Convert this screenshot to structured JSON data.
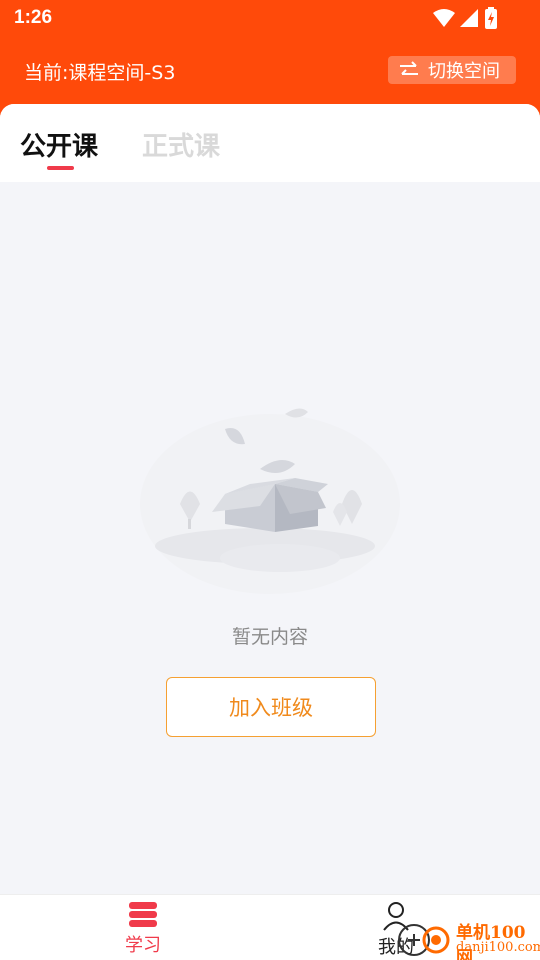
{
  "status_bar": {
    "time": "1:26",
    "icons": [
      "wifi-icon",
      "signal-icon",
      "battery-icon"
    ]
  },
  "header": {
    "current_space": "当前:课程空间-S3",
    "switch_label": "切换空间",
    "background_color": "#ff4a0a"
  },
  "tabs": [
    {
      "label": "公开课",
      "active": true
    },
    {
      "label": "正式课",
      "active": false
    }
  ],
  "empty_state": {
    "message": "暂无内容",
    "join_button": "加入班级"
  },
  "bottom_nav": [
    {
      "label": "学习",
      "icon": "study-icon",
      "active": true,
      "color": "#f03a4a"
    },
    {
      "label": "我的",
      "icon": "person-icon",
      "active": false
    }
  ],
  "watermark": {
    "title": "单机100网",
    "url": "danji100.com"
  }
}
